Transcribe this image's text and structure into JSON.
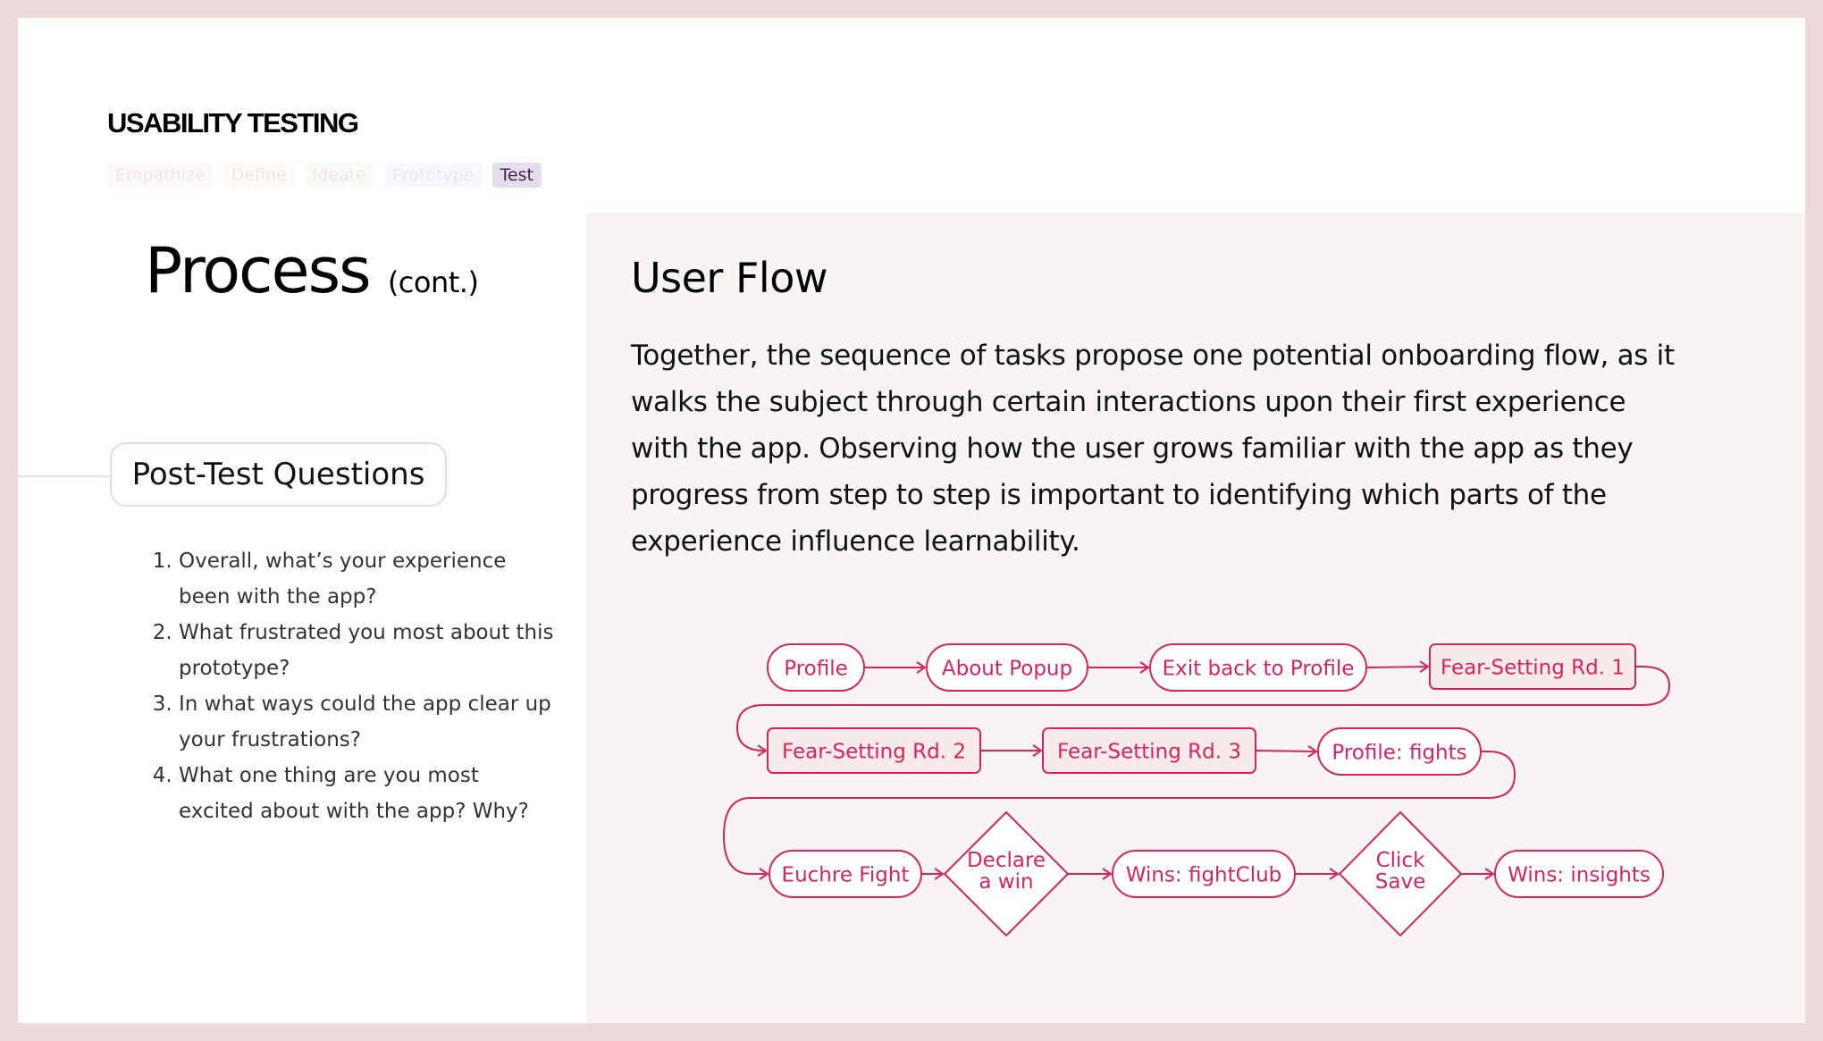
{
  "header": {
    "eyebrow": "USABILITY TESTING",
    "tabs": [
      {
        "label": "Empathize",
        "active": false
      },
      {
        "label": "Define",
        "active": false
      },
      {
        "label": "Ideate",
        "active": false
      },
      {
        "label": "Prototype",
        "active": false
      },
      {
        "label": "Test",
        "active": true
      }
    ]
  },
  "left": {
    "title": "Process",
    "title_suffix": "(cont.)",
    "section_label": "Post-Test Questions",
    "questions": [
      "Overall, what’s your experience been with the app?",
      "What frustrated you most about this prototype?",
      "In what ways could the app clear up your frustrations?",
      "What one thing are you most excited about with the app? Why?"
    ]
  },
  "right": {
    "title": "User Flow",
    "body": "Together, the sequence of tasks propose one potential onboarding flow, as it walks the subject through certain interactions upon their first experience with the app. Observing how the user grows familiar with the app as they progress from step to step is important to identifying which parts of the experience influence learnability."
  },
  "colors": {
    "accent": "#d6245e",
    "panel_bg": "#f9f4f4",
    "border_bg": "#ecdadb",
    "task_fill": "#f7eaea",
    "node_fill": "#ffffff"
  },
  "flow": {
    "nodes": [
      {
        "id": "n1",
        "label": "Profile",
        "shape": "pill"
      },
      {
        "id": "n2",
        "label": "About Popup",
        "shape": "pill"
      },
      {
        "id": "n3",
        "label": "Exit back to Profile",
        "shape": "pill"
      },
      {
        "id": "n4",
        "label": "Fear-Setting Rd. 1",
        "shape": "rect"
      },
      {
        "id": "n5",
        "label": "Fear-Setting Rd. 2",
        "shape": "rect"
      },
      {
        "id": "n6",
        "label": "Fear-Setting Rd. 3",
        "shape": "rect"
      },
      {
        "id": "n7",
        "label": "Profile: fights",
        "shape": "pill"
      },
      {
        "id": "n8",
        "label": "Euchre Fight",
        "shape": "pill"
      },
      {
        "id": "n9",
        "label": "Declare\na win",
        "shape": "diamond"
      },
      {
        "id": "n10",
        "label": "Wins: fightClub",
        "shape": "pill"
      },
      {
        "id": "n11",
        "label": "Click\nSave",
        "shape": "diamond"
      },
      {
        "id": "n12",
        "label": "Wins: insights",
        "shape": "pill"
      }
    ],
    "edges": [
      [
        "n1",
        "n2"
      ],
      [
        "n2",
        "n3"
      ],
      [
        "n3",
        "n4"
      ],
      [
        "n4",
        "n5"
      ],
      [
        "n5",
        "n6"
      ],
      [
        "n6",
        "n7"
      ],
      [
        "n7",
        "n8"
      ],
      [
        "n8",
        "n9"
      ],
      [
        "n9",
        "n10"
      ],
      [
        "n10",
        "n11"
      ],
      [
        "n11",
        "n12"
      ]
    ]
  }
}
